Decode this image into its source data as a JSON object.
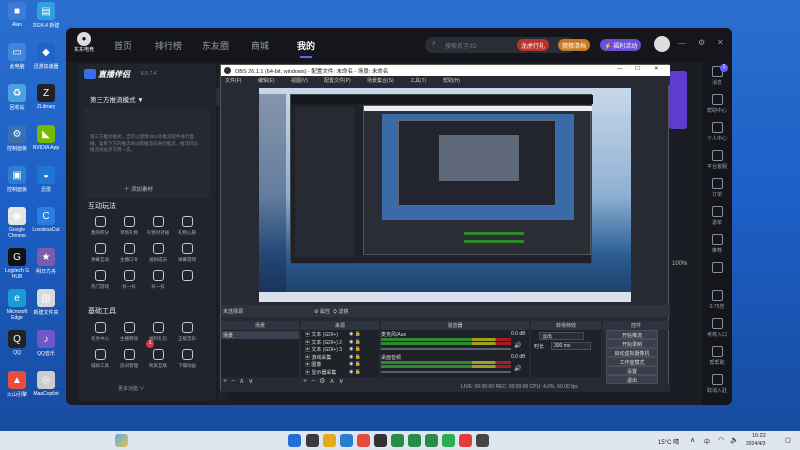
{
  "desktop_icons": [
    {
      "label": "Alan",
      "color": "#3d7bd9",
      "glyph": "■"
    },
    {
      "label": "2024.4 新建",
      "color": "#2f9fe0",
      "glyph": "▤"
    },
    {
      "label": "此电脑",
      "color": "#3f86d6",
      "glyph": "▭"
    },
    {
      "label": "迅游加速器",
      "color": "#1f63c7",
      "glyph": "◆"
    },
    {
      "label": "回收站",
      "color": "#4aa3e0",
      "glyph": "♻"
    },
    {
      "label": "ZLibrary",
      "color": "#222",
      "glyph": "Z"
    },
    {
      "label": "控制面板",
      "color": "#3b6fb0",
      "glyph": "⚙"
    },
    {
      "label": "NVIDIA App",
      "color": "#76b900",
      "glyph": "◣"
    },
    {
      "label": "控制面板",
      "color": "#2c7fd0",
      "glyph": "▣"
    },
    {
      "label": "迅雷",
      "color": "#1e76d2",
      "glyph": "◒"
    },
    {
      "label": "Google Chrome",
      "color": "#e5e5e5",
      "glyph": "◉"
    },
    {
      "label": "LosslessCut",
      "color": "#2a7de1",
      "glyph": "C"
    },
    {
      "label": "Logitech G HUB",
      "color": "#111",
      "glyph": "G"
    },
    {
      "label": "明日方舟",
      "color": "#7a5ca8",
      "glyph": "★"
    },
    {
      "label": "Microsoft Edge",
      "color": "#1a9ad7",
      "glyph": "e"
    },
    {
      "label": "新建文件夹",
      "color": "#d9d9d9",
      "glyph": "▥"
    },
    {
      "label": "QQ",
      "color": "#222",
      "glyph": "Q"
    },
    {
      "label": "QQ音乐",
      "color": "#6e57c8",
      "glyph": "♪"
    },
    {
      "label": "火山引擎",
      "color": "#e84c3d",
      "glyph": "▲"
    },
    {
      "label": "MaaCopilot",
      "color": "#ccc",
      "glyph": "◎"
    }
  ],
  "dongdong": {
    "logo": "东东电竞",
    "nav": [
      "首页",
      "排行榜",
      "东友圈",
      "商城",
      "我的"
    ],
    "active_nav": "我的",
    "search_placeholder": "搜索名字/ID",
    "pills": [
      {
        "label": "龙虎行礼",
        "color": "#c0392b"
      },
      {
        "label": "猜猜清档",
        "color": "#d4802a"
      },
      {
        "label": "⚡ 福利活动",
        "color": "#6b4ed8"
      }
    ],
    "right_sidebar": [
      "消息",
      "帮助中心",
      "个人中心",
      "平台客服",
      "订单",
      "退单",
      "推荐",
      "",
      "0.75倍",
      "考核入口",
      "帮帮助",
      "取消入驻"
    ],
    "right_sidebar_badge": "1",
    "middle_text": "100%"
  },
  "companion": {
    "title": "直播伴侣",
    "version": "6.5.7.4",
    "mode": "第三方推流模式 ▼",
    "desc": "第三方推流模式，当可以使用OBS等推流软件进行直播，复制下方的推流地址和推流码进行推流。推流码与推流地址仅可用一次。",
    "add_material": "＋ 添加素材",
    "interact_title": "互动玩法",
    "interact": [
      "我的积分",
      "单场礼物",
      "礼物对对碰",
      "礼物心愿",
      "弹幕互动",
      "主播口令",
      "送粉成员",
      "弹幕游戏",
      "热门游戏",
      "抖一抖",
      "抖一抖",
      ""
    ],
    "tools_title": "基础工具",
    "tools": [
      "任务中心",
      "主播特效",
      "福利礼包",
      "正版音乐",
      "辅助工具",
      "房间管理",
      "跨屏互联",
      "下播动画"
    ],
    "tools_badge": "1",
    "more": "更多功能 ∨"
  },
  "obs": {
    "title": "OBS 26.1.1 (64-bit, windows) - 配置文件: 未命名 - 场景: 未命名",
    "menu": [
      "文件(F)",
      "编辑(E)",
      "视图(V)",
      "配置文件(P)",
      "场景集合(S)",
      "工具(T)",
      "帮助(H)"
    ],
    "docks": [
      "场景",
      "来源",
      "混音器",
      "转场特效",
      "控件"
    ],
    "preview_label": "未选择源",
    "props_button": "⚙ 属性",
    "filter_button": "⛭ 滤镜",
    "scene": "场景",
    "sources": [
      "文本 (GDI+)",
      "文本 (GDI+) 2",
      "文本 (GDI+) 3",
      "游戏采集",
      "图像",
      "显示器采集"
    ],
    "mixer": [
      {
        "name": "麦克风/Aux",
        "db": "0.0 dB"
      },
      {
        "name": "桌面音频",
        "db": "0.0 dB"
      }
    ],
    "transition": "淡出",
    "duration_label": "时长",
    "duration": "300 ms",
    "controls": [
      "开始推流",
      "开始录制",
      "启动虚拟摄像机",
      "工作室模式",
      "设置",
      "退出"
    ],
    "status": "LIVE: 00:00:00    REC: 00:00:00    CPU: 4.0%, 60.00 fps"
  },
  "taskbar": {
    "weather": "15°C 晴",
    "ime": "中",
    "time": "16:22",
    "date": "2024/4/3"
  }
}
